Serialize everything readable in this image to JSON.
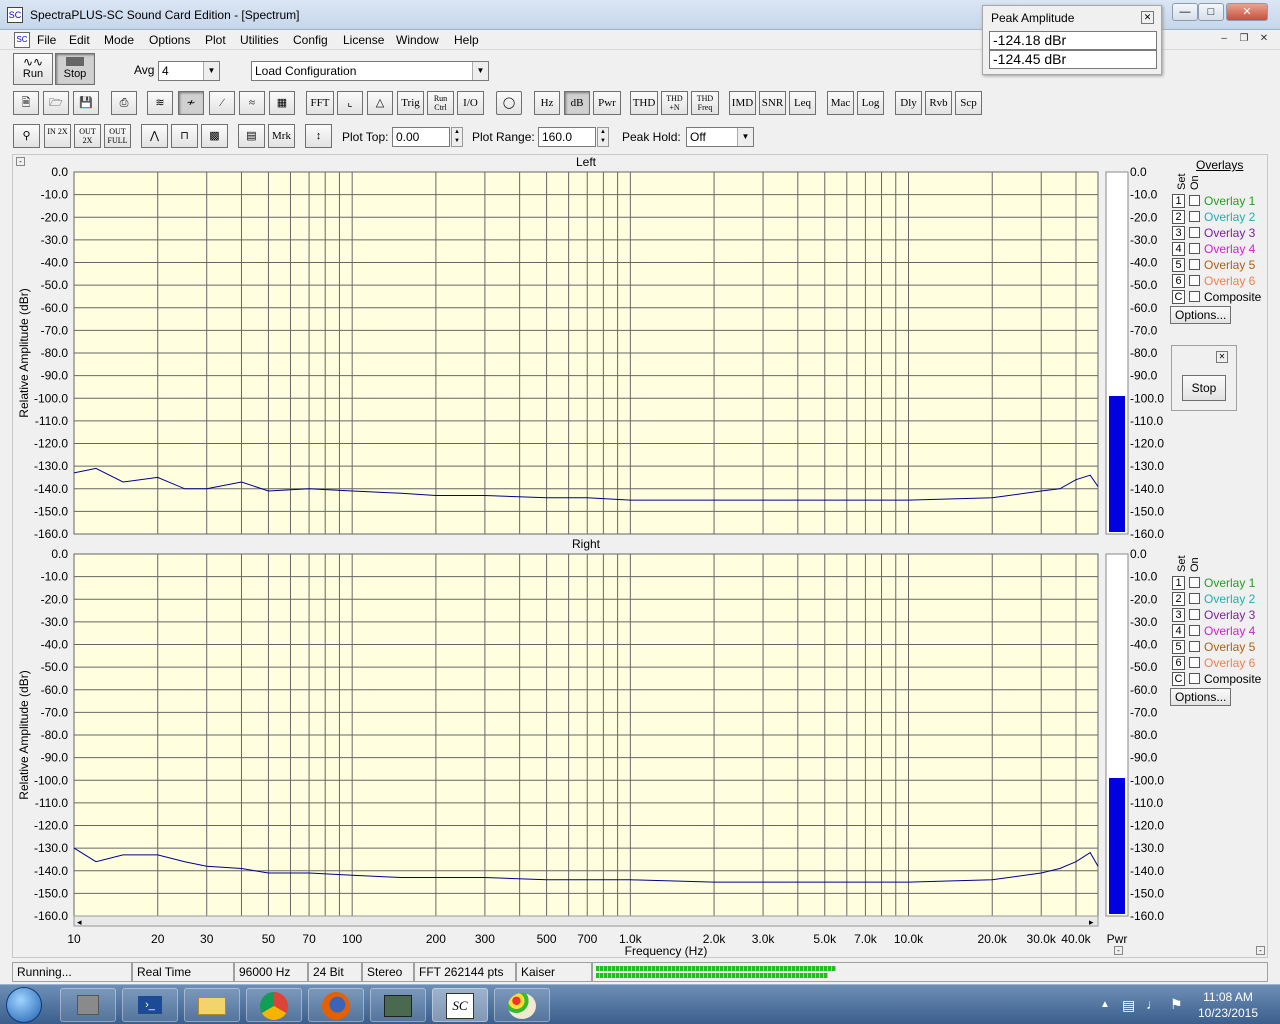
{
  "window": {
    "title": "SpectraPLUS-SC Sound Card Edition - [Spectrum]",
    "app_icon": "SC"
  },
  "menu": [
    "File",
    "Edit",
    "Mode",
    "Options",
    "Plot",
    "Utilities",
    "Config",
    "License",
    "Window",
    "Help"
  ],
  "toolbar1": {
    "run_label": "Run",
    "stop_label": "Stop",
    "avg_label": "Avg",
    "avg_value": "4",
    "config_value": "Load Configuration"
  },
  "toolbar2": [
    "FFT",
    "Trig",
    "Run Ctrl",
    "I/O",
    "Hz",
    "dB",
    "Pwr",
    "THD",
    "THD +N",
    "THD Freq",
    "IMD",
    "SNR",
    "Leq",
    "Mac",
    "Log",
    "Dly",
    "Rvb",
    "Scp"
  ],
  "toolbar3": {
    "zoom_in": "IN 2X",
    "zoom_out": "OUT 2X",
    "zoom_full": "OUT FULL",
    "marker": "Mrk",
    "plot_top_label": "Plot Top:",
    "plot_top_value": "0.00",
    "plot_range_label": "Plot Range:",
    "plot_range_value": "160.0",
    "peak_hold_label": "Peak Hold:",
    "peak_hold_value": "Off"
  },
  "peak": {
    "title": "Peak Amplitude",
    "value1": "-124.18 dBr",
    "value2": "-124.45 dBr"
  },
  "overlays": {
    "title": "Overlays",
    "set_label": "Set",
    "on_label": "On",
    "items": [
      {
        "num": "1",
        "label": "Overlay 1",
        "color": "#20a020"
      },
      {
        "num": "2",
        "label": "Overlay 2",
        "color": "#20b0b0"
      },
      {
        "num": "3",
        "label": "Overlay 3",
        "color": "#8020a0"
      },
      {
        "num": "4",
        "label": "Overlay 4",
        "color": "#d020d0"
      },
      {
        "num": "5",
        "label": "Overlay 5",
        "color": "#b06010"
      },
      {
        "num": "6",
        "label": "Overlay 6",
        "color": "#f08050"
      },
      {
        "num": "C",
        "label": "Composite",
        "color": "#000000"
      }
    ],
    "options_label": "Options..."
  },
  "stop_panel": {
    "label": "Stop"
  },
  "status": {
    "state": "Running...",
    "mode": "Real Time",
    "rate": "96000 Hz",
    "bits": "24 Bit",
    "channels": "Stereo",
    "fft": "FFT 262144 pts",
    "window": "Kaiser"
  },
  "clock": {
    "time": "11:08 AM",
    "date": "10/23/2015"
  },
  "taskbar_icons": [
    "start-orb-icon",
    "server-manager-icon",
    "powershell-icon",
    "file-explorer-icon",
    "chrome-icon",
    "firefox-icon",
    "network-icon",
    "spectraplus-icon",
    "paint-icon"
  ],
  "chart_data": [
    {
      "type": "line",
      "title": "Left",
      "xlabel": "Frequency (Hz)",
      "ylabel": "Relative Amplitude (dBr)",
      "x_scale": "log",
      "xlim": [
        10,
        48000
      ],
      "ylim": [
        -160,
        0
      ],
      "grid": true,
      "x_tick_labels": [
        "10",
        "20",
        "30",
        "50",
        "70",
        "100",
        "200",
        "300",
        "500",
        "700",
        "1.0k",
        "2.0k",
        "3.0k",
        "5.0k",
        "7.0k",
        "10.0k",
        "20.0k",
        "30.0k",
        "40.0k"
      ],
      "x_ticks": [
        10,
        20,
        30,
        50,
        70,
        100,
        200,
        300,
        500,
        700,
        1000,
        2000,
        3000,
        5000,
        7000,
        10000,
        20000,
        30000,
        40000
      ],
      "y_ticks": [
        "0.0",
        "-10.0",
        "-20.0",
        "-30.0",
        "-40.0",
        "-50.0",
        "-60.0",
        "-70.0",
        "-80.0",
        "-90.0",
        "-100.0",
        "-110.0",
        "-120.0",
        "-130.0",
        "-140.0",
        "-150.0",
        "-160.0"
      ],
      "series": [
        {
          "color": "#00008b",
          "x": [
            10,
            12,
            15,
            20,
            25,
            30,
            40,
            50,
            70,
            100,
            150,
            200,
            300,
            500,
            700,
            1000,
            2000,
            5000,
            10000,
            20000,
            30000,
            35000,
            40000,
            45000,
            48000
          ],
          "y": [
            -133,
            -131,
            -137,
            -135,
            -140,
            -140,
            -137,
            -141,
            -140,
            -141,
            -142,
            -143,
            -143,
            -144,
            -144,
            -145,
            -145,
            -145,
            -145,
            -144,
            -141,
            -140,
            -136,
            -134,
            -139
          ]
        }
      ],
      "pwr_label": "Pwr",
      "pwr_level_db": -99
    },
    {
      "type": "line",
      "title": "Right",
      "xlabel": "Frequency (Hz)",
      "ylabel": "Relative Amplitude (dBr)",
      "x_scale": "log",
      "xlim": [
        10,
        48000
      ],
      "ylim": [
        -160,
        0
      ],
      "grid": true,
      "x_tick_labels": [
        "10",
        "20",
        "30",
        "50",
        "70",
        "100",
        "200",
        "300",
        "500",
        "700",
        "1.0k",
        "2.0k",
        "3.0k",
        "5.0k",
        "7.0k",
        "10.0k",
        "20.0k",
        "30.0k",
        "40.0k"
      ],
      "x_ticks": [
        10,
        20,
        30,
        50,
        70,
        100,
        200,
        300,
        500,
        700,
        1000,
        2000,
        3000,
        5000,
        7000,
        10000,
        20000,
        30000,
        40000
      ],
      "y_ticks": [
        "0.0",
        "-10.0",
        "-20.0",
        "-30.0",
        "-40.0",
        "-50.0",
        "-60.0",
        "-70.0",
        "-80.0",
        "-90.0",
        "-100.0",
        "-110.0",
        "-120.0",
        "-130.0",
        "-140.0",
        "-150.0",
        "-160.0"
      ],
      "series": [
        {
          "color": "#00008b",
          "x": [
            10,
            12,
            15,
            20,
            25,
            30,
            40,
            50,
            70,
            100,
            150,
            200,
            300,
            500,
            700,
            1000,
            2000,
            5000,
            10000,
            20000,
            30000,
            35000,
            40000,
            45000,
            48000
          ],
          "y": [
            -130,
            -136,
            -133,
            -133,
            -136,
            -138,
            -139,
            -141,
            -141,
            -142,
            -143,
            -143,
            -143,
            -144,
            -144,
            -144,
            -145,
            -145,
            -145,
            -144,
            -141,
            -139,
            -136,
            -132,
            -138
          ]
        }
      ],
      "pwr_label": "Pwr",
      "pwr_level_db": -99
    }
  ]
}
